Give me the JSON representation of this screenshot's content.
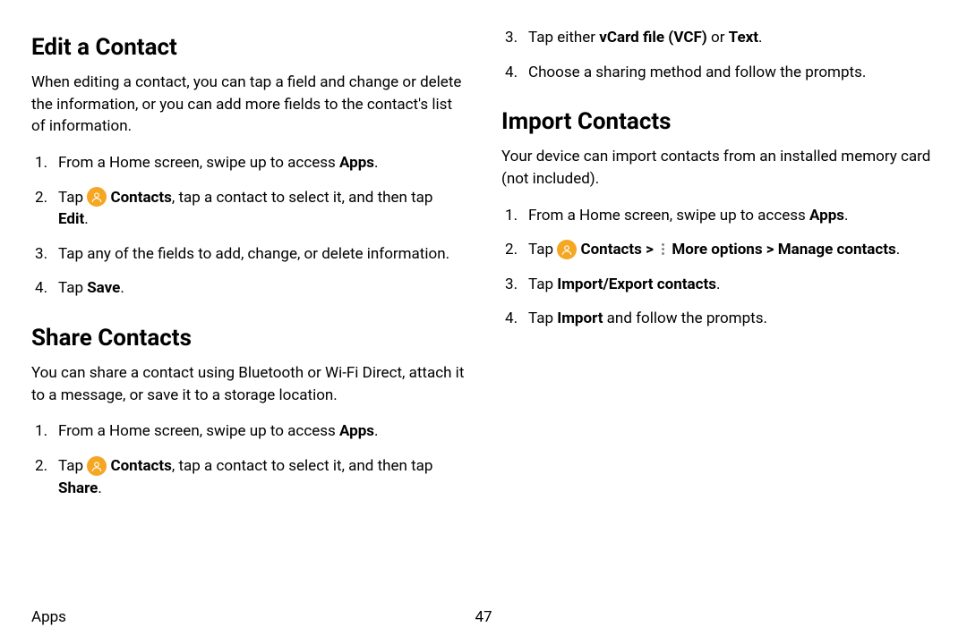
{
  "left": {
    "edit": {
      "heading": "Edit a Contact",
      "intro": "When editing a contact, you can tap a field and change or delete the information, or you can add more fields to the contact's list of information.",
      "step1_pre": "From a Home screen, swipe up to access ",
      "step1_bold": "Apps",
      "step1_post": ".",
      "step2_pre": "Tap ",
      "step2_bold1": " Contacts",
      "step2_mid": ", tap a contact to select it, and then tap ",
      "step2_bold2": "Edit",
      "step2_post": ".",
      "step3": "Tap any of the fields to add, change, or delete information.",
      "step4_pre": "Tap ",
      "step4_bold": "Save",
      "step4_post": "."
    },
    "share": {
      "heading": "Share Contacts",
      "intro": "You can share a contact using Bluetooth or Wi-Fi Direct, attach it to a message, or save it to a storage location.",
      "step1_pre": "From a Home screen, swipe up to access ",
      "step1_bold": "Apps",
      "step1_post": ".",
      "step2_pre": "Tap ",
      "step2_bold1": " Contacts",
      "step2_mid": ", tap a contact to select it, and then tap ",
      "step2_bold2": "Share",
      "step2_post": "."
    }
  },
  "right": {
    "cont": {
      "step3_pre": "Tap either ",
      "step3_bold1": "vCard file (VCF)",
      "step3_mid": " or ",
      "step3_bold2": "Text",
      "step3_post": ".",
      "step4": "Choose a sharing method and follow the prompts."
    },
    "import": {
      "heading": "Import Contacts",
      "intro": "Your device can import contacts from an installed memory card (not included).",
      "step1_pre": "From a Home screen, swipe up to access ",
      "step1_bold": "Apps",
      "step1_post": ".",
      "step2_pre": "Tap ",
      "step2_bold1": " Contacts ",
      "step2_chev1": ">",
      "step2_bold2": " More options ",
      "step2_chev2": ">",
      "step2_bold3": " Manage contacts",
      "step2_post": ".",
      "step3_pre": "Tap ",
      "step3_bold": "Import/Export contacts",
      "step3_post": ".",
      "step4_pre": "Tap ",
      "step4_bold": "Import",
      "step4_post": " and follow the prompts."
    }
  },
  "footer": {
    "label": "Apps",
    "page": "47"
  }
}
